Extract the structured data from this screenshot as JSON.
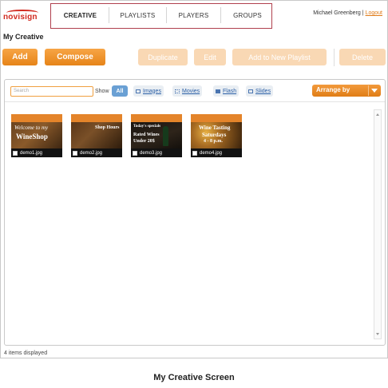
{
  "brand": {
    "name": "novisign"
  },
  "nav": {
    "items": [
      {
        "label": "CREATIVE"
      },
      {
        "label": "PLAYLISTS"
      },
      {
        "label": "PLAYERS"
      },
      {
        "label": "GROUPS"
      }
    ]
  },
  "user": {
    "name": "Michael Greenberg",
    "separator": "|",
    "logout": "Logout"
  },
  "page": {
    "title": "My Creative"
  },
  "toolbar": {
    "add": "Add",
    "compose": "Compose",
    "duplicate": "Duplicate",
    "edit": "Edit",
    "add_to_playlist": "Add to New Playlist",
    "delete": "Delete"
  },
  "filter": {
    "search_placeholder": "Search",
    "show_label": "Show",
    "all": "All",
    "images": "Images",
    "movies": "Movies",
    "flash": "Flash",
    "slides": "Slides",
    "arrange_by": "Arrange by"
  },
  "items": [
    {
      "filename": "demo1.jpg",
      "lines": [
        "Welcome to my",
        "WineShop"
      ]
    },
    {
      "filename": "demo2.jpg",
      "lines": [
        "Shop Hours"
      ]
    },
    {
      "filename": "demo3.jpg",
      "lines": [
        "Today's specials",
        "Rated Wines",
        "Under 20$"
      ]
    },
    {
      "filename": "demo4.jpg",
      "lines": [
        "Wine Tasting",
        "Saturdays",
        "4 - 8 p.m."
      ]
    }
  ],
  "status": {
    "count_text": "4 items displayed"
  },
  "caption": "My Creative Screen",
  "colors": {
    "accent": "#e68419",
    "nav_highlight": "#b0404e",
    "link": "#2b5fa6",
    "filter_active": "#6aa0d4"
  }
}
